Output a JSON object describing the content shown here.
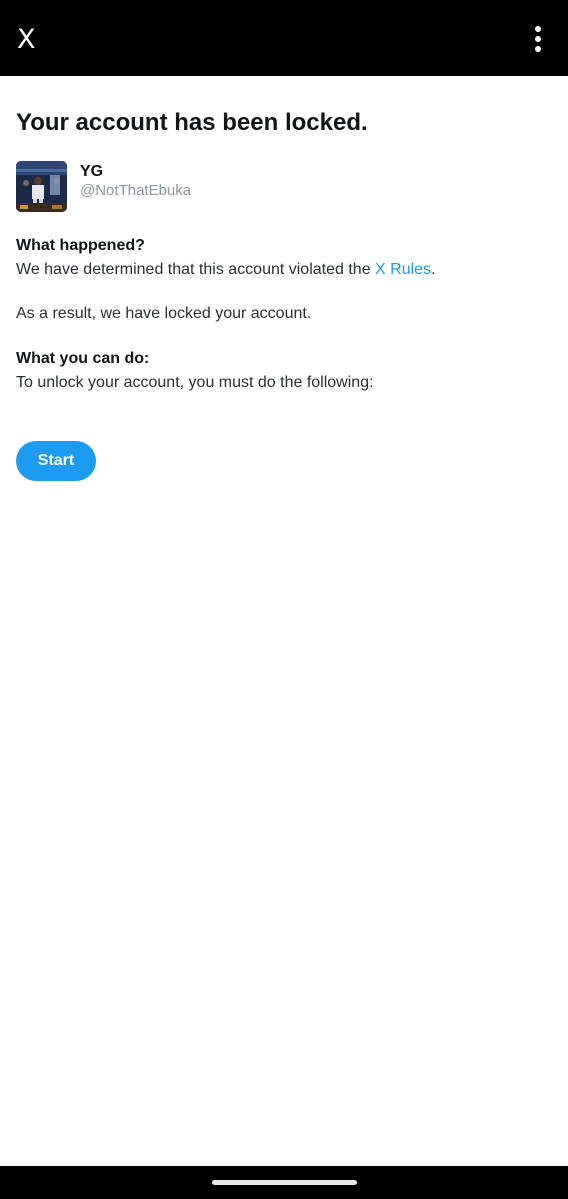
{
  "header": {
    "close_icon": "close-icon",
    "close_glyph": "X",
    "more_icon": "more-vertical-icon"
  },
  "page": {
    "title": "Your account has been locked."
  },
  "account": {
    "name": "YG",
    "handle": "@NotThatEbuka",
    "avatar_icon": "avatar-image"
  },
  "what_happened": {
    "heading": "What happened?",
    "text_before_link": "We have determined that this account violated the ",
    "link_text": "X Rules",
    "text_after_link": "."
  },
  "result": {
    "text": "As a result, we have locked your account."
  },
  "what_you_can_do": {
    "heading": "What you can do:",
    "text": "To unlock your account, you must do the following:"
  },
  "actions": {
    "start_label": "Start"
  },
  "colors": {
    "accent": "#1d9bf0",
    "bar": "#000000",
    "handle": "#8a96a3"
  }
}
